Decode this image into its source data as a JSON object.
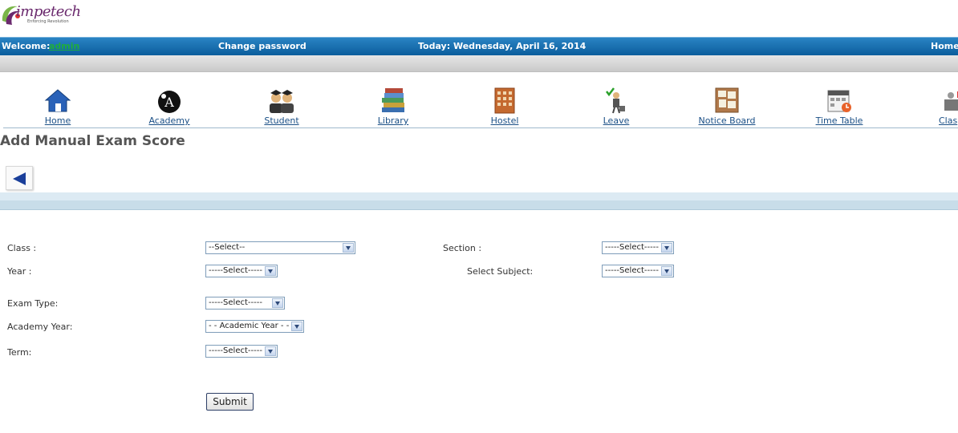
{
  "logo": {
    "text": "impetech",
    "tagline": "Enforcing Revolution"
  },
  "topbar": {
    "welcome_label": "Welcome:",
    "welcome_user": "admin",
    "change_password": "Change password",
    "today": "Today: Wednesday, April 16, 2014",
    "home": "Home"
  },
  "nav": {
    "items": [
      {
        "label": "Home",
        "icon": "home-icon"
      },
      {
        "label": "Academy",
        "icon": "academy-icon"
      },
      {
        "label": "Student",
        "icon": "student-icon"
      },
      {
        "label": "Library",
        "icon": "books-icon"
      },
      {
        "label": "Hostel",
        "icon": "building-icon"
      },
      {
        "label": "Leave",
        "icon": "leave-icon"
      },
      {
        "label": "Notice Board",
        "icon": "notice-board-icon"
      },
      {
        "label": "Time Table",
        "icon": "timetable-icon"
      },
      {
        "label": "Clas",
        "icon": "class-icon"
      }
    ]
  },
  "page": {
    "title": "Add Manual Exam Score",
    "back_icon": "back-arrow-icon"
  },
  "form": {
    "class_label": "Class :",
    "class_value": "--Select--",
    "section_label": "Section :",
    "section_value": "-----Select-----",
    "year_label": "Year :",
    "year_value": "-----Select-----",
    "subject_label": "Select Subject:",
    "subject_value": "-----Select-----",
    "exam_type_label": "Exam Type:",
    "exam_type_value": "-----Select-----",
    "academy_year_label": "Academy Year:",
    "academy_year_value": "- - Academic Year - -",
    "term_label": "Term:",
    "term_value": "-----Select-----",
    "submit_label": "Submit"
  }
}
